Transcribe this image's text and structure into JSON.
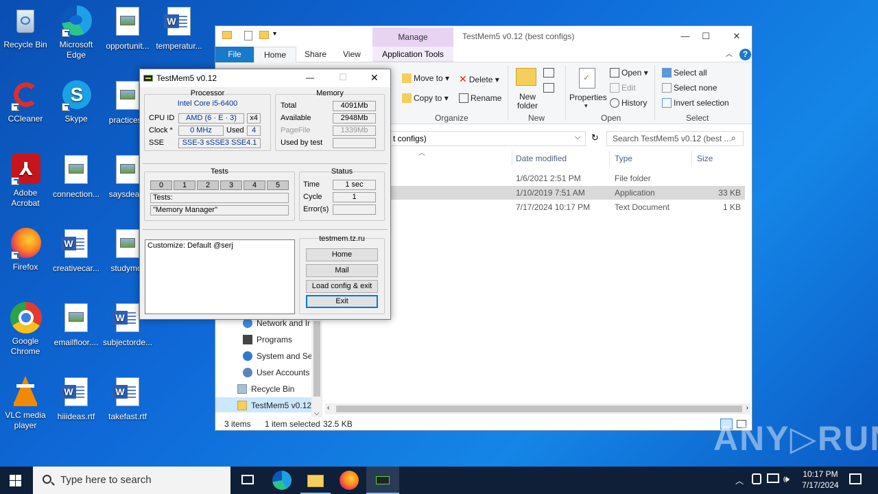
{
  "desktop": {
    "icons": [
      {
        "label": "Recycle Bin"
      },
      {
        "label": "Microsoft Edge"
      },
      {
        "label": "opportunit..."
      },
      {
        "label": "temperatur..."
      },
      {
        "label": "CCleaner"
      },
      {
        "label": "Skype"
      },
      {
        "label": "practicesu"
      },
      {
        "label": "Adobe Acrobat"
      },
      {
        "label": "connection..."
      },
      {
        "label": "saysdeath"
      },
      {
        "label": "Firefox"
      },
      {
        "label": "creativecar..."
      },
      {
        "label": "studymor"
      },
      {
        "label": "Google Chrome"
      },
      {
        "label": "emailfloor...."
      },
      {
        "label": "subjectorde..."
      },
      {
        "label": "VLC media player"
      },
      {
        "label": "hiiideas.rtf"
      },
      {
        "label": "takefast.rtf"
      }
    ]
  },
  "explorer": {
    "title": "TestMem5 v0.12 (best configs)",
    "manage": "Manage",
    "app_tools": "Application Tools",
    "tabs": {
      "file": "File",
      "home": "Home",
      "share": "Share",
      "view": "View"
    },
    "ribbon": {
      "move_to": "Move to",
      "copy_to": "Copy to",
      "delete": "Delete",
      "rename": "Rename",
      "new_folder_1": "New",
      "new_folder_2": "folder",
      "properties": "Properties",
      "open": "Open",
      "edit": "Edit",
      "history": "History",
      "select_all": "Select all",
      "select_none": "Select none",
      "invert_selection": "Invert selection",
      "groups": {
        "organize": "Organize",
        "new": "New",
        "open": "Open",
        "select": "Select"
      }
    },
    "address_text": "t configs)",
    "search_placeholder": "Search TestMem5 v0.12 (best ...",
    "columns": {
      "date": "Date modified",
      "type": "Type",
      "size": "Size"
    },
    "rows": [
      {
        "date": "1/6/2021 2:51 PM",
        "type": "File folder",
        "size": ""
      },
      {
        "date": "1/10/2019 7:51 AM",
        "type": "Application",
        "size": "33 KB"
      },
      {
        "date": "7/17/2024 10:17 PM",
        "type": "Text Document",
        "size": "1 KB"
      }
    ],
    "nav": {
      "network": "Network and Ir",
      "programs": "Programs",
      "system": "System and Sec",
      "user_accounts": "User Accounts",
      "recycle_bin": "Recycle Bin",
      "testmem": "TestMem5 v0.12"
    },
    "status": {
      "items": "3 items",
      "selected": "1 item selected",
      "size": "32.5 KB"
    }
  },
  "testmem": {
    "title": "TestMem5 v0.12",
    "processor": {
      "heading": "Processor",
      "name": "Intel Core i5-6400",
      "cpu_id_label": "CPU ID",
      "cpu_id": "AMD  (6 · E · 3)",
      "threads": "x4",
      "clock_label": "Clock *",
      "clock": "0 MHz",
      "used_label": "Used",
      "used": "4",
      "sse_label": "SSE",
      "sse": "SSE-3 sSSE3 SSE4.1"
    },
    "memory": {
      "heading": "Memory",
      "total_label": "Total",
      "total": "4091Mb",
      "available_label": "Available",
      "available": "2948Mb",
      "pagefile_label": "PageFile",
      "pagefile": "1339Mb",
      "used_by_test_label": "Used by test",
      "used_by_test": ""
    },
    "tests": {
      "heading": "Tests",
      "numbers": [
        "0",
        "1",
        "2",
        "3",
        "4",
        "5"
      ],
      "tests_line": "Tests:",
      "current": "\"Memory Manager\""
    },
    "status": {
      "heading": "Status",
      "time_label": "Time",
      "time": "1 sec",
      "cycle_label": "Cycle",
      "cycle": "1",
      "errors_label": "Error(s)",
      "errors": ""
    },
    "log": "Customize: Default @serj",
    "site": {
      "heading": "testmem.tz.ru",
      "home": "Home",
      "mail": "Mail",
      "load_exit": "Load config & exit",
      "exit": "Exit"
    }
  },
  "taskbar": {
    "search_placeholder": "Type here to search",
    "time": "10:17 PM",
    "date": "7/17/2024"
  },
  "watermark": "ANY▷RUN"
}
